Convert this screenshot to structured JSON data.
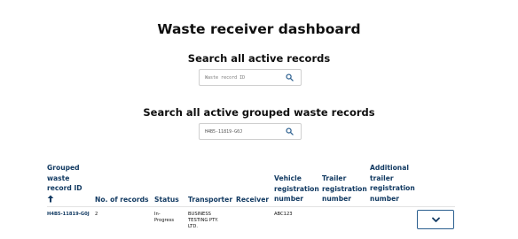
{
  "page": {
    "title": "Waste receiver dashboard"
  },
  "search_records": {
    "heading": "Search all active records",
    "placeholder": "Waste record ID",
    "value": ""
  },
  "search_grouped": {
    "heading": "Search all active grouped waste records",
    "placeholder": "",
    "value": "H4B5-11819-G0J"
  },
  "icons": {
    "search": "search-icon",
    "expand": "chevron-down-icon",
    "sort": "arrow-up-icon"
  },
  "colors": {
    "heading_text": "#0f0f0f",
    "table_header_text": "#123a62",
    "button_border": "#2b5f8f"
  },
  "table": {
    "headers": {
      "group_id": [
        "Grouped",
        "waste",
        "record ID"
      ],
      "num_records": "No. of records",
      "status": "Status",
      "transporter": "Transporter",
      "receiver": "Receiver",
      "vehicle": [
        "Vehicle",
        "registration",
        "number"
      ],
      "trailer": [
        "Trailer",
        "registration",
        "number"
      ],
      "additional_trailer": [
        "Additional",
        "trailer",
        "registration",
        "number"
      ]
    },
    "rows": [
      {
        "group_id": "H4B5-11819-G0J",
        "num_records": "2",
        "status": [
          "In-",
          "Progress"
        ],
        "transporter": [
          "BUSINESS",
          "TESTING PTY.",
          "LTD."
        ],
        "receiver": "",
        "vehicle": "ABC123",
        "trailer": "",
        "additional_trailer": ""
      }
    ]
  }
}
